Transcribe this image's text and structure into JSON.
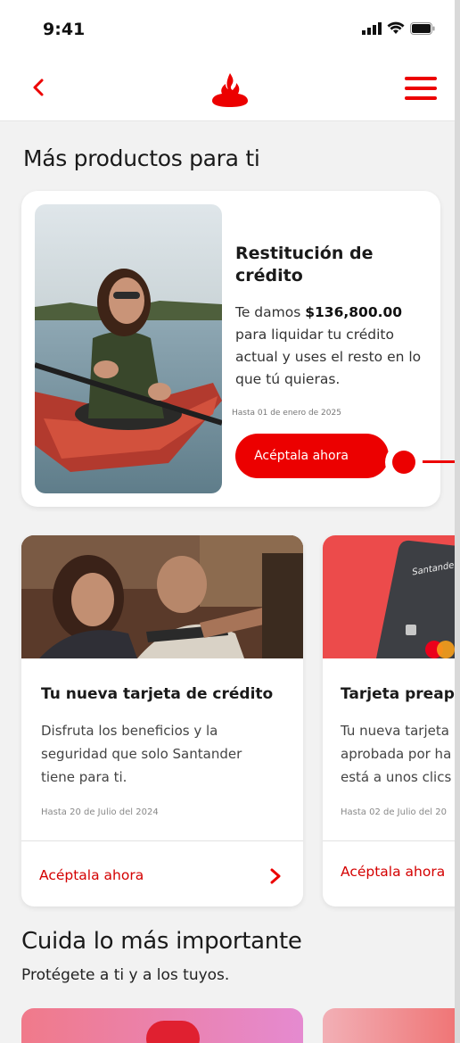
{
  "status": {
    "time": "9:41"
  },
  "header": {
    "back_icon": "chevron-left-icon",
    "logo_icon": "santander-flame-icon",
    "menu_icon": "hamburger-menu-icon"
  },
  "colors": {
    "brand_red": "#ec0000",
    "background": "#f2f2f2",
    "card": "#ffffff"
  },
  "sections": {
    "more_products": {
      "title": "Más productos para ti"
    },
    "care": {
      "title": "Cuida lo más importante",
      "subtitle": "Protégete a ti y a los tuyos."
    }
  },
  "featured": {
    "title": "Restitución de crédito",
    "desc_prefix": "Te damos ",
    "amount": "$136,800.00",
    "desc_suffix": " para liquidar tu crédito actual y uses el resto en lo que tú quieras.",
    "note": "Hasta 01 de enero de 2025",
    "cta": "Acéptala ahora"
  },
  "products": [
    {
      "title": "Tu nueva tarjeta de crédito",
      "desc_lines": [
        "Disfruta los beneficios y la",
        "seguridad que solo Santander",
        "tiene para ti."
      ],
      "note": "Hasta 20 de Julio del 2024",
      "cta": "Acéptala ahora"
    },
    {
      "title": "Tarjeta preapr",
      "desc_lines": [
        "Tu nueva tarjeta",
        "aprobada por ha",
        "está a unos clics"
      ],
      "note": "Hasta 02 de Julio del 20",
      "cta": "Acéptala ahora",
      "card_brand": "Santander"
    }
  ]
}
